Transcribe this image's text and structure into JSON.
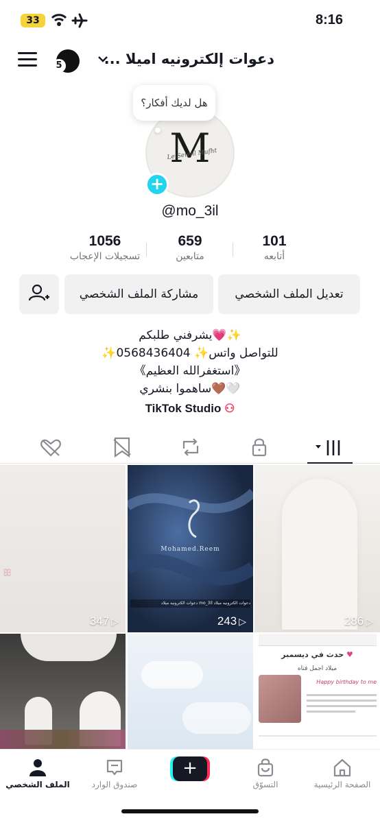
{
  "status_bar": {
    "battery": "33",
    "time": "8:16"
  },
  "header": {
    "title": "دعوات إلكترونيه اميلا ...",
    "notification_count": "5"
  },
  "profile": {
    "bubble": "هل لديك أفكار؟",
    "avatar_letter": "M",
    "avatar_script": "Le Seienl Mufht",
    "username": "@mo_3il"
  },
  "stats": [
    {
      "value": "101",
      "label": "أتابعه"
    },
    {
      "value": "659",
      "label": "متابعين"
    },
    {
      "value": "1056",
      "label": "تسجيلات الإعجاب"
    }
  ],
  "buttons": {
    "edit": "تعديل الملف الشخصي",
    "share": "مشاركة الملف الشخصي"
  },
  "bio": [
    "يشرفني طلبكم💗✨",
    "✨للتواصل واتس✨ 0568436404",
    "《استغفرالله العظيم》",
    "ساهموا بنشري🤎🤍"
  ],
  "studio": "TikTok Studio",
  "grid": [
    {
      "views": "286",
      "bg": "#ece9e5"
    },
    {
      "views": "243",
      "bg": "#1f2f4c",
      "overlay": "Mohamed.Reem",
      "caption": "دعوات الكترونيه ميلاد mo_3il دعوات الكترونيه ميلاد"
    },
    {
      "views": "347",
      "bg": "#ebe8e6"
    },
    {
      "title": "حدث في ديسمبر",
      "subtitle": "ميلاد اجمل فتاه",
      "greeting": "Happy birthday to me"
    },
    {
      "bg": "#d9e6f2"
    },
    {
      "bg": "#2b2b2b"
    }
  ],
  "nav": [
    {
      "label": "الصفحة الرئيسية"
    },
    {
      "label": "التسوّق"
    },
    {
      "label": "صندوق الوارد"
    },
    {
      "label": "الملف الشخصي"
    }
  ],
  "colors": {
    "accent": "#fe2c55",
    "cyan": "#25f4ee",
    "text": "#161823"
  }
}
